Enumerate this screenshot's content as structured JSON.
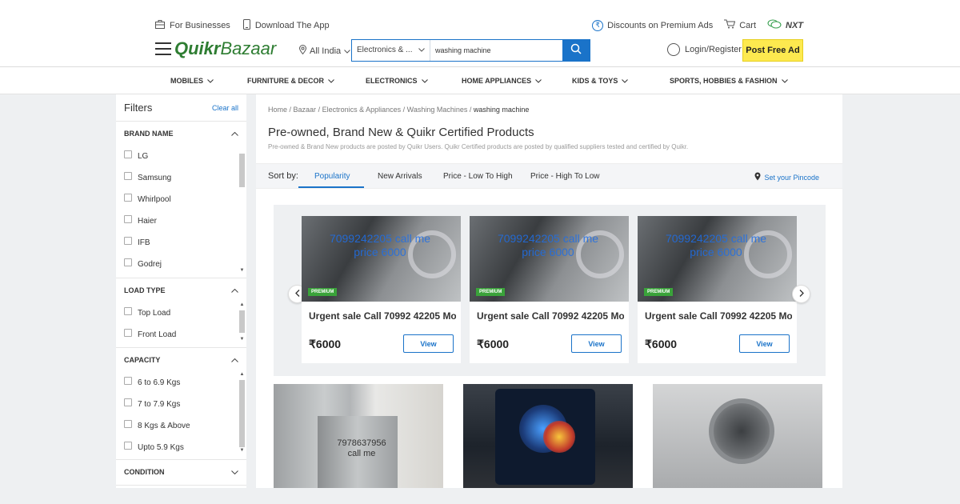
{
  "header": {
    "util_left": [
      {
        "label": "For Businesses",
        "icon": "briefcase-icon"
      },
      {
        "label": "Download The App",
        "icon": "phone-icon"
      }
    ],
    "util_right": {
      "discounts": "Discounts on Premium Ads",
      "cart": "Cart",
      "nxt": "NXT"
    },
    "logo": {
      "part1": "Quikr",
      "part2": "Bazaar"
    },
    "location": "All India",
    "search": {
      "category": "Electronics & ...",
      "value": "washing machine",
      "placeholder": ""
    },
    "login": "Login/Register",
    "post_ad": "Post Free Ad"
  },
  "category_nav": [
    {
      "label": "MOBILES"
    },
    {
      "label": "FURNITURE & DECOR"
    },
    {
      "label": "ELECTRONICS"
    },
    {
      "label": "HOME APPLIANCES"
    },
    {
      "label": "KIDS & TOYS"
    },
    {
      "label": "SPORTS, HOBBIES & FASHION"
    }
  ],
  "filters": {
    "title": "Filters",
    "clear": "Clear all",
    "sections": [
      {
        "title": "BRAND NAME",
        "options": [
          "LG",
          "Samsung",
          "Whirlpool",
          "Haier",
          "IFB",
          "Godrej"
        ]
      },
      {
        "title": "LOAD TYPE",
        "options": [
          "Top Load",
          "Front Load"
        ]
      },
      {
        "title": "CAPACITY",
        "options": [
          "6 to 6.9 Kgs",
          "7 to 7.9 Kgs",
          "8 Kgs & Above",
          "Upto 5.9 Kgs"
        ]
      },
      {
        "title": "CONDITION",
        "options": []
      }
    ]
  },
  "content": {
    "breadcrumb": [
      "Home",
      "Bazaar",
      "Electronics & Appliances",
      "Washing Machines",
      "washing machine"
    ],
    "heading": "Pre-owned, Brand New & Quikr Certified Products",
    "subheading": "Pre-owned & Brand New products are posted by Quikr Users. Quikr Certified products are posted by qualified suppliers tested and certified by Quikr.",
    "sort_label": "Sort by:",
    "sort_options": [
      "Popularity",
      "New Arrivals",
      "Price - Low To High",
      "Price - High To Low"
    ],
    "active_sort": "Popularity",
    "pincode": "Set your Pincode",
    "premium_cards": [
      {
        "watermark": "7099242205 call me price 6000",
        "badge": "PREMIUM",
        "title": "Urgent sale Call 70992 42205 Mo...",
        "price": "₹6000",
        "cta": "View"
      },
      {
        "watermark": "7099242205 call me price 6000",
        "badge": "PREMIUM",
        "title": "Urgent sale Call 70992 42205 Mo...",
        "price": "₹6000",
        "cta": "View"
      },
      {
        "watermark": "7099242205 call me price 6000",
        "badge": "PREMIUM",
        "title": "Urgent sale Call 70992 42205 Mo...",
        "price": "₹6000",
        "cta": "View"
      }
    ],
    "listing_thumbs": [
      {
        "caption": "7978637956 call me"
      },
      {
        "caption": ""
      },
      {
        "caption": ""
      }
    ]
  },
  "colors": {
    "brand_green": "#2e7d32",
    "accent_blue": "#1a73c9",
    "post_ad_yellow": "#fde94f",
    "premium_badge": "#3aa33a"
  }
}
